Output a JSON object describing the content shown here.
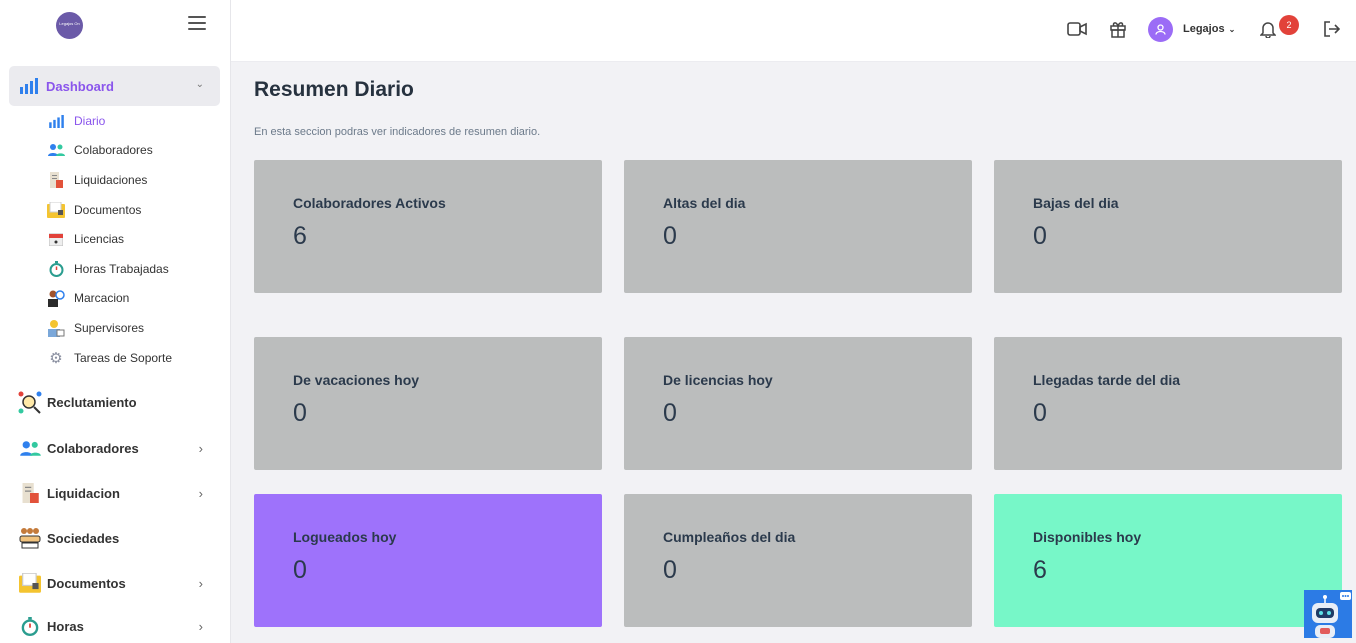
{
  "logo": {
    "text": "Legajos On"
  },
  "sidebar": {
    "dashboard": {
      "label": "Dashboard"
    },
    "sub_items": [
      {
        "label": "Diario",
        "icon": "bar-chart-icon",
        "active": true
      },
      {
        "label": "Colaboradores",
        "icon": "people-icon"
      },
      {
        "label": "Liquidaciones",
        "icon": "receipt-icon"
      },
      {
        "label": "Documentos",
        "icon": "folder-icon"
      },
      {
        "label": "Licencias",
        "icon": "calendar-icon"
      },
      {
        "label": "Horas Trabajadas",
        "icon": "stopwatch-icon"
      },
      {
        "label": "Marcacion",
        "icon": "clock-user-icon"
      },
      {
        "label": "Supervisores",
        "icon": "supervisor-icon"
      },
      {
        "label": "Tareas de Soporte",
        "icon": "gear-icon"
      }
    ],
    "main_items": [
      {
        "label": "Reclutamiento",
        "icon": "recruitment-icon",
        "has_arrow": false
      },
      {
        "label": "Colaboradores",
        "icon": "people-icon",
        "has_arrow": true
      },
      {
        "label": "Liquidacion",
        "icon": "receipt-icon",
        "has_arrow": true
      },
      {
        "label": "Sociedades",
        "icon": "handshake-icon",
        "has_arrow": false
      },
      {
        "label": "Documentos",
        "icon": "folder-icon",
        "has_arrow": true
      },
      {
        "label": "Horas",
        "icon": "stopwatch-icon",
        "has_arrow": true
      }
    ]
  },
  "topbar": {
    "user": "Legajos",
    "notifications": "2"
  },
  "page": {
    "title": "Resumen Diario",
    "subtitle": "En esta seccion podras ver indicadores de resumen diario."
  },
  "cards": [
    {
      "title": "Colaboradores Activos",
      "value": "6",
      "color": "#bbbdbd"
    },
    {
      "title": "Altas del dia",
      "value": "0",
      "color": "#bbbdbd"
    },
    {
      "title": "Bajas del dia",
      "value": "0",
      "color": "#bbbdbd"
    },
    {
      "title": "De vacaciones hoy",
      "value": "0",
      "color": "#bbbdbd"
    },
    {
      "title": "De licencias hoy",
      "value": "0",
      "color": "#bbbdbd"
    },
    {
      "title": "Llegadas tarde del dia",
      "value": "0",
      "color": "#bbbdbd"
    },
    {
      "title": "Logueados hoy",
      "value": "0",
      "color": "#9e72fb"
    },
    {
      "title": "Cumpleaños del dia",
      "value": "0",
      "color": "#bbbdbd"
    },
    {
      "title": "Disponibles hoy",
      "value": "6",
      "color": "#77f7c8"
    }
  ]
}
